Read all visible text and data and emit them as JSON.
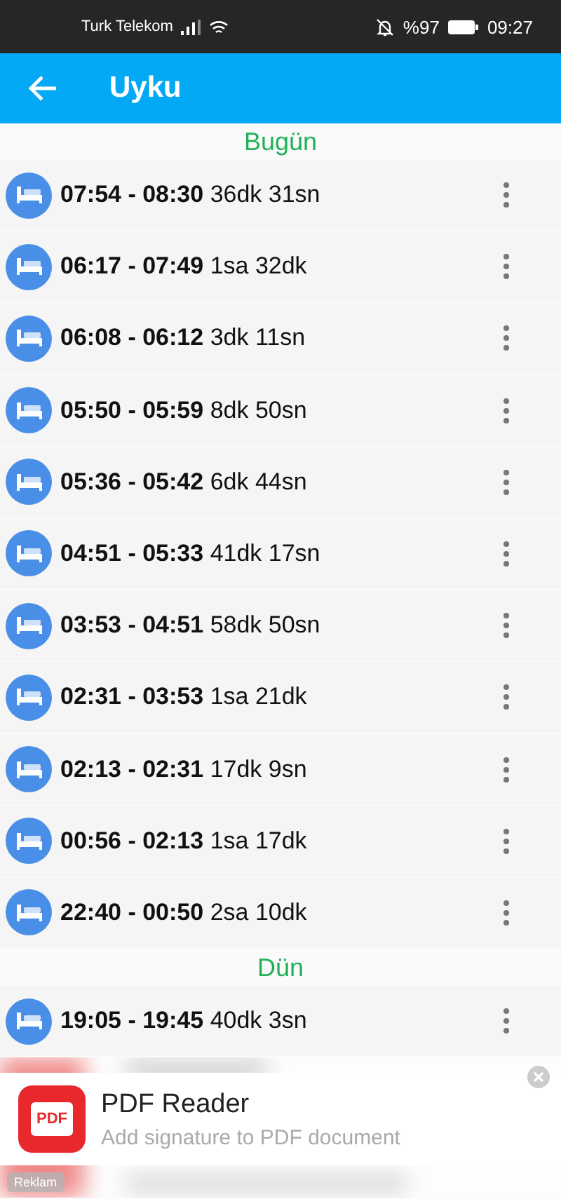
{
  "status_bar": {
    "carrier": "Turk Telekom",
    "battery_text": "%97",
    "time": "09:27"
  },
  "app_bar": {
    "title": "Uyku"
  },
  "sections": [
    {
      "header": "Bugün",
      "entries": [
        {
          "range": "07:54 - 08:30",
          "duration": "36dk 31sn"
        },
        {
          "range": "06:17 - 07:49",
          "duration": "1sa 32dk"
        },
        {
          "range": "06:08 - 06:12",
          "duration": "3dk 11sn"
        },
        {
          "range": "05:50 - 05:59",
          "duration": "8dk 50sn"
        },
        {
          "range": "05:36 - 05:42",
          "duration": "6dk 44sn"
        },
        {
          "range": "04:51 - 05:33",
          "duration": "41dk 17sn"
        },
        {
          "range": "03:53 - 04:51",
          "duration": "58dk 50sn"
        },
        {
          "range": "02:31 - 03:53",
          "duration": "1sa 21dk"
        },
        {
          "range": "02:13 - 02:31",
          "duration": "17dk 9sn"
        },
        {
          "range": "00:56 - 02:13",
          "duration": "1sa 17dk"
        },
        {
          "range": "22:40 - 00:50",
          "duration": "2sa 10dk"
        }
      ]
    },
    {
      "header": "Dün",
      "entries": [
        {
          "range": "19:05 - 19:45",
          "duration": "40dk 3sn"
        }
      ]
    }
  ],
  "ad": {
    "icon_text": "PDF",
    "title": "PDF Reader",
    "subtitle": "Add signature to PDF document",
    "label": "Reklam"
  }
}
